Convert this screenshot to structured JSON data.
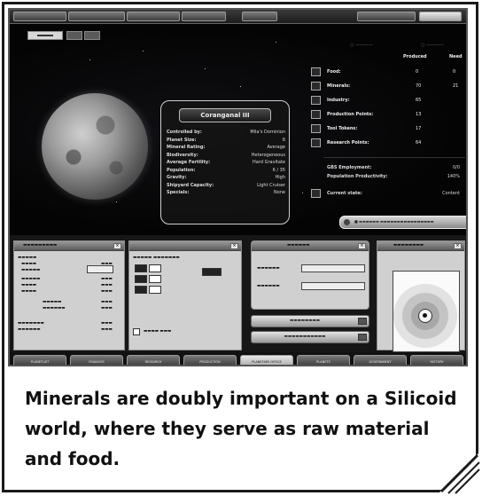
{
  "caption": "Minerals are doubly important on a Silicoid world, where they serve as raw material and food.",
  "planet": {
    "name": "Coranganal III",
    "info": [
      {
        "key": "Controlled by:",
        "value": "Mila's Dominion"
      },
      {
        "key": "Planet Size:",
        "value": "6"
      },
      {
        "key": "Mineral Rating:",
        "value": "Average"
      },
      {
        "key": "Biodiversity:",
        "value": "Heterogeneous"
      },
      {
        "key": "Average Fertility:",
        "value": "Hard Gravitate"
      },
      {
        "key": "Population:",
        "value": "6 / 35"
      },
      {
        "key": "Gravity:",
        "value": "High"
      },
      {
        "key": "Shipyard Capacity:",
        "value": "Light Cruiser"
      },
      {
        "key": "Specials:",
        "value": "None"
      }
    ]
  },
  "stats": {
    "produced_label": "Produced",
    "need_label": "Need",
    "rows": [
      {
        "icon": "food-icon",
        "label": "Food:",
        "produced": "0",
        "need": "0"
      },
      {
        "icon": "minerals-icon",
        "label": "Minerals:",
        "produced": "70",
        "need": "21"
      },
      {
        "icon": "industry-icon",
        "label": "Industry:",
        "produced": "65",
        "need": ""
      },
      {
        "icon": "production-icon",
        "label": "Production Points:",
        "produced": "13",
        "need": ""
      },
      {
        "icon": "tax-icon",
        "label": "Tool Tokens:",
        "produced": "17",
        "need": ""
      },
      {
        "icon": "research-icon",
        "label": "Research Points:",
        "produced": "64",
        "need": ""
      }
    ],
    "extra": [
      {
        "label": "GBS Employment:",
        "value": "0/0"
      },
      {
        "label": "Population Productivity:",
        "value": "140%"
      }
    ],
    "current_state_label": "Current state:",
    "current_state_value": "Content"
  },
  "bottom_tabs": [
    {
      "label": "PLANETLIST"
    },
    {
      "label": "FINANCES"
    },
    {
      "label": "RESEARCH"
    },
    {
      "label": "PRODUCTION"
    },
    {
      "label": "PLANETARY OFFICE"
    },
    {
      "label": "PLANETS"
    },
    {
      "label": "GOVERNMENT"
    },
    {
      "label": "HISTORY"
    }
  ]
}
